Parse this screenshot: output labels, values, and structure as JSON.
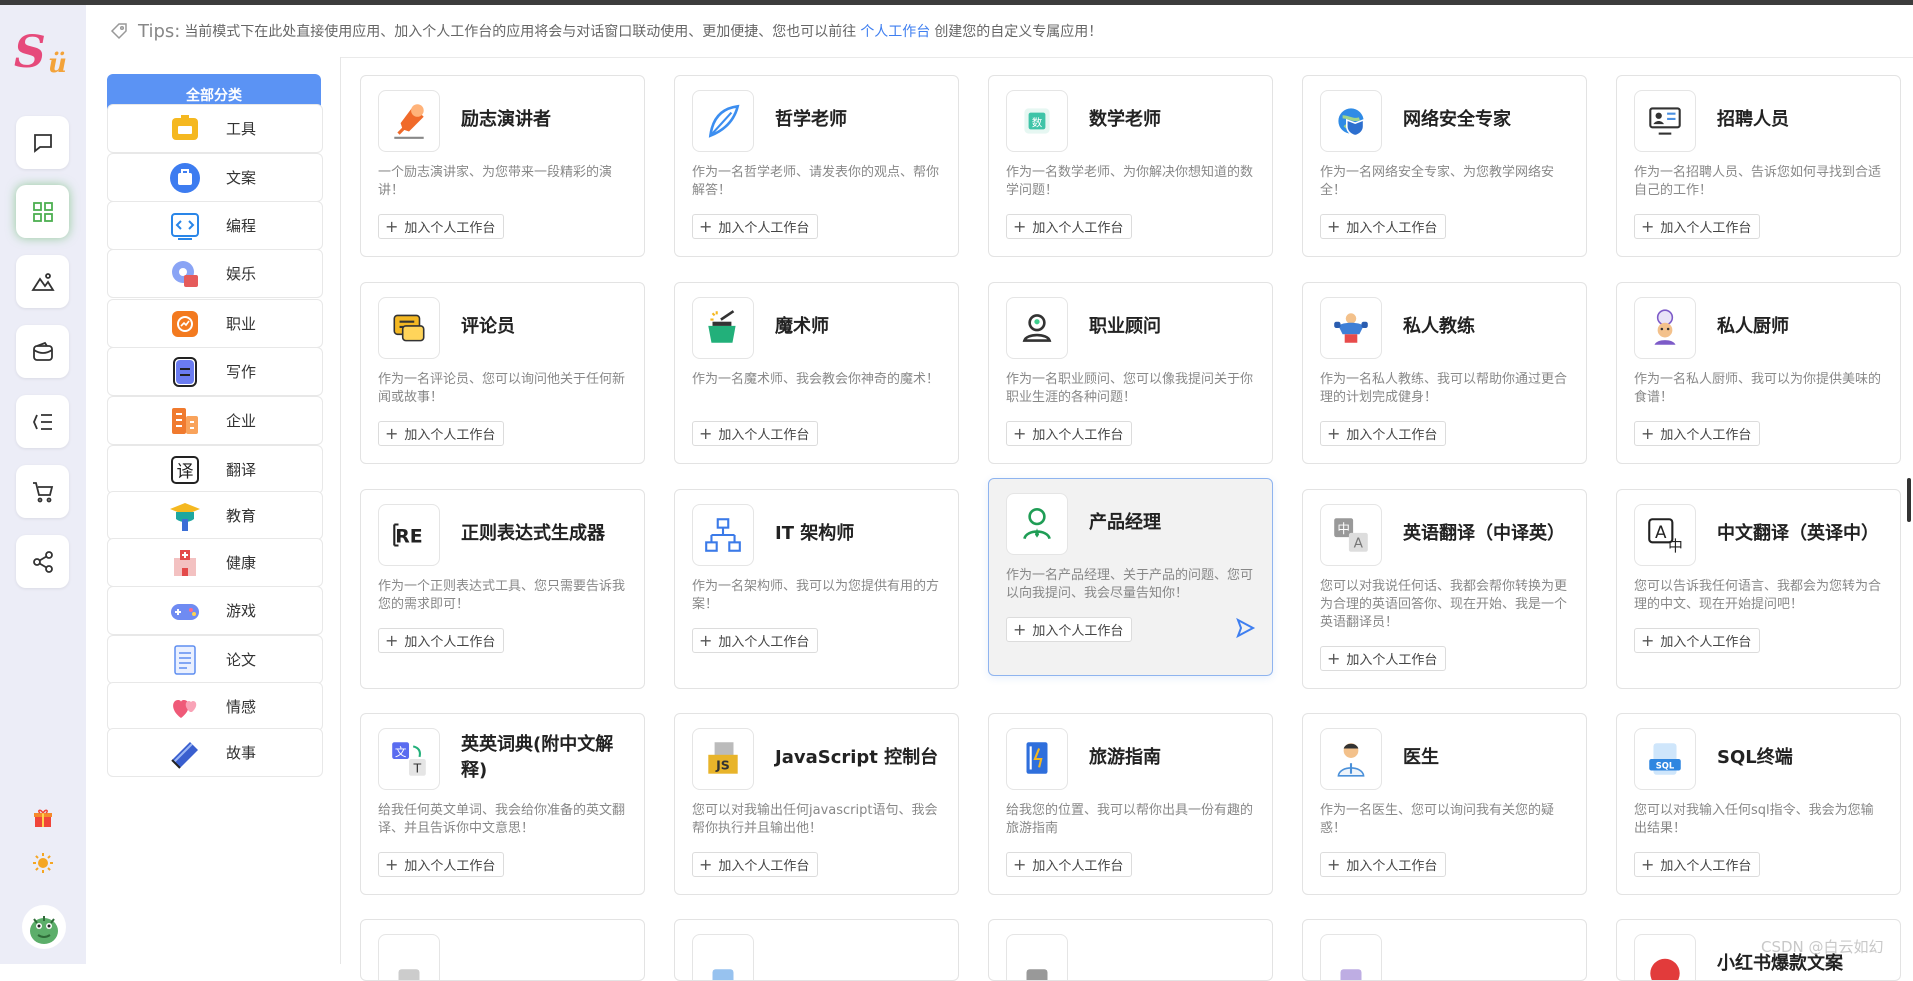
{
  "app": {
    "logo_text": "S",
    "logo_sub": "ü"
  },
  "tips": {
    "label": "Tips:",
    "text_before": "当前模式下在此处直接使用应用、加入个人工作台的应用将会与对话窗口联动使用、更加便捷、您也可以前往",
    "link": "个人工作台",
    "text_after": "创建您的自定义专属应用！"
  },
  "rail": {
    "items": [
      "chat-icon",
      "apps-icon",
      "image-icon",
      "wallet-icon",
      "list-icon",
      "cart-icon",
      "share-icon"
    ],
    "active": "apps-icon",
    "accent": "#4caf50"
  },
  "categories": {
    "all_label": "全部分类",
    "items": [
      {
        "label": "工具",
        "icon": "toolbox-icon",
        "color": "#f5b820"
      },
      {
        "label": "文案",
        "icon": "briefcase-icon",
        "color": "#3d7cf0"
      },
      {
        "label": "编程",
        "icon": "code-icon",
        "color": "#2a86e8"
      },
      {
        "label": "娱乐",
        "icon": "film-icon",
        "color": "#e55b5b"
      },
      {
        "label": "职业",
        "icon": "chart-icon",
        "color": "#f37a1f"
      },
      {
        "label": "写作",
        "icon": "notebook-icon",
        "color": "#6b7cf0"
      },
      {
        "label": "企业",
        "icon": "building-icon",
        "color": "#f07a2e"
      },
      {
        "label": "翻译",
        "icon": "translate-icon",
        "color": "#222222"
      },
      {
        "label": "教育",
        "icon": "cap-icon",
        "color": "#1fa7a0"
      },
      {
        "label": "健康",
        "icon": "hospital-icon",
        "color": "#e34a4a"
      },
      {
        "label": "游戏",
        "icon": "gamepad-icon",
        "color": "#6f8bf2"
      },
      {
        "label": "论文",
        "icon": "paper-icon",
        "color": "#5e8ef0"
      },
      {
        "label": "情感",
        "icon": "hearts-icon",
        "color": "#ef5a78"
      },
      {
        "label": "故事",
        "icon": "book-icon",
        "color": "#3a5fcf"
      }
    ]
  },
  "add_label": "加入个人工作台",
  "cards": [
    {
      "title": "励志演讲者",
      "desc": "一个励志演讲家、为您带来一段精彩的演讲！",
      "icon": "speaker-icon",
      "color": "#f06a2a"
    },
    {
      "title": "哲学老师",
      "desc": "作为一名哲学老师、请发表你的观点、帮你解答！",
      "icon": "feather-icon",
      "color": "#3c8ef0"
    },
    {
      "title": "数学老师",
      "desc": "作为一名数学老师、为你解决你想知道的数学问题！",
      "icon": "math-icon",
      "color": "#3fc4a8"
    },
    {
      "title": "网络安全专家",
      "desc": "作为一名网络安全专家、为您教学网络安全！",
      "icon": "shield-icon",
      "color": "#2f8be6"
    },
    {
      "title": "招聘人员",
      "desc": "作为一名招聘人员、告诉您如何寻找到合适自己的工作！",
      "icon": "recruit-icon",
      "color": "#333333"
    },
    {
      "title": "评论员",
      "desc": "作为一名评论员、您可以询问他关于任何新闻或故事！",
      "icon": "comment-icon",
      "color": "#f4b822"
    },
    {
      "title": "魔术师",
      "desc": "作为一名魔术师、我会教会你神奇的魔术！",
      "icon": "magic-icon",
      "color": "#22b07a"
    },
    {
      "title": "职业顾问",
      "desc": "作为一名职业顾问、您可以像我提问关于你职业生涯的各种问题！",
      "icon": "advisor-icon",
      "color": "#333333"
    },
    {
      "title": "私人教练",
      "desc": "作为一名私人教练、我可以帮助你通过更合理的计划完成健身！",
      "icon": "trainer-icon",
      "color": "#3f7fd6"
    },
    {
      "title": "私人厨师",
      "desc": "作为一名私人厨师、我可以为你提供美味的食谱！",
      "icon": "chef-icon",
      "color": "#7d5bc8"
    },
    {
      "title": "正则表达式生成器",
      "desc": "作为一个正则表达式工具、您只需要告诉我您的需求即可！",
      "icon": "regex-icon",
      "color": "#222222"
    },
    {
      "title": "IT 架构师",
      "desc": "作为一名架构师、我可以为您提供有用的方案！",
      "icon": "architecture-icon",
      "color": "#3b7ae8"
    },
    {
      "title": "产品经理",
      "desc": "作为一名产品经理、关于产品的问题、您可以向我提问、我会尽量告知你！",
      "icon": "product-icon",
      "color": "#1f9d55"
    },
    {
      "title": "英语翻译（中译英）",
      "desc": "您可以对我说任何话、我都会帮你转换为更为合理的英语回答你、现在开始、我是一个英语翻译员！",
      "icon": "translate-zh-en-icon",
      "color": "#777777"
    },
    {
      "title": "中文翻译（英译中）",
      "desc": "您可以告诉我任何语言、我都会为您转为合理的中文、现在开始提问吧！",
      "icon": "translate-en-zh-icon",
      "color": "#222222"
    },
    {
      "title": "英英词典(附中文解释)",
      "desc": "给我任何英文单词、我会给你准备的英文翻译、并且告诉你中文意思！",
      "icon": "dictionary-icon",
      "color": "#5a6cf0"
    },
    {
      "title": "JavaScript 控制台",
      "desc": "您可以对我输出任何javascript语句、我会帮你执行并且输出他！",
      "icon": "js-icon",
      "color": "#e8b42a"
    },
    {
      "title": "旅游指南",
      "desc": "给我您的位置、我可以帮你出具一份有趣的旅游指南",
      "icon": "guide-icon",
      "color": "#2f6fdc"
    },
    {
      "title": "医生",
      "desc": "作为一名医生、您可以询问我有关您的疑惑！",
      "icon": "doctor-icon",
      "color": "#4a90d9"
    },
    {
      "title": "SQL终端",
      "desc": "您可以对我输入任何sql指令、我会为您输出结果！",
      "icon": "sql-icon",
      "color": "#2f86e0"
    },
    {
      "title": "",
      "desc": "",
      "icon": "placeholder-icon",
      "color": "#999999"
    },
    {
      "title": "",
      "desc": "",
      "icon": "placeholder-icon",
      "color": "#2f86e0"
    },
    {
      "title": "",
      "desc": "",
      "icon": "placeholder-icon",
      "color": "#333333"
    },
    {
      "title": "",
      "desc": "",
      "icon": "placeholder-icon",
      "color": "#7d5bc8"
    },
    {
      "title": "小红书爆款文案",
      "desc": "",
      "icon": "redbook-icon",
      "color": "#e23b3b"
    }
  ],
  "watermark": "CSDN @白云如幻"
}
